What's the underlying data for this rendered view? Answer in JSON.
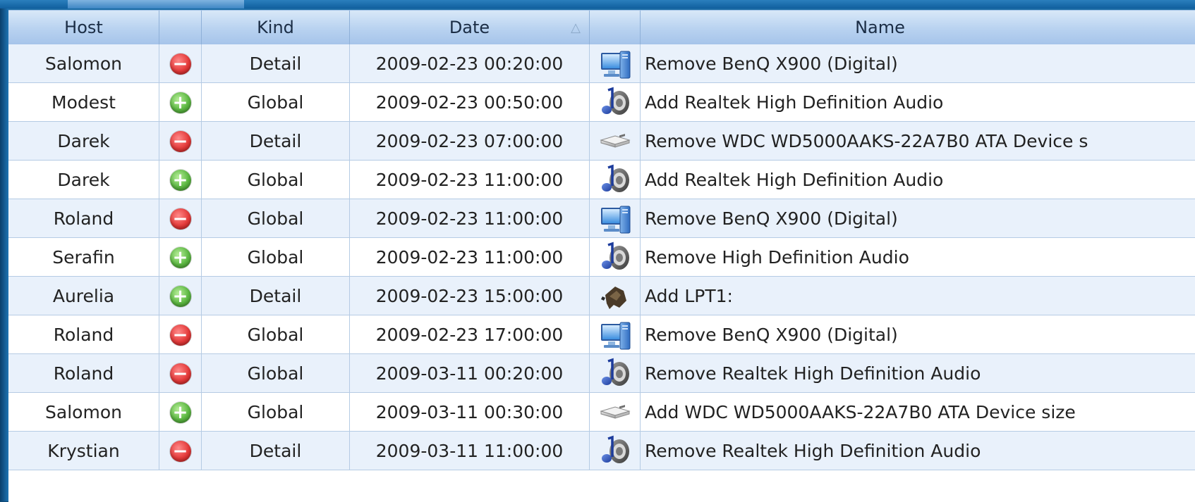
{
  "columns": {
    "host": "Host",
    "status": "",
    "kind": "Kind",
    "date": "Date",
    "sort_indicator": "△",
    "icon": "",
    "name": "Name"
  },
  "rows": [
    {
      "host": "Salomon",
      "action": "remove",
      "kind": "Detail",
      "date": "2009-02-23 00:20:00",
      "device_icon": "monitor-icon",
      "name": "Remove BenQ X900 (Digital)"
    },
    {
      "host": "Modest",
      "action": "add",
      "kind": "Global",
      "date": "2009-02-23 00:50:00",
      "device_icon": "audio-icon",
      "name": "Add Realtek High Definition Audio"
    },
    {
      "host": "Darek",
      "action": "remove",
      "kind": "Detail",
      "date": "2009-02-23 07:00:00",
      "device_icon": "hard-disk-icon",
      "name": "Remove WDC WD5000AAKS-22A7B0 ATA Device s"
    },
    {
      "host": "Darek",
      "action": "add",
      "kind": "Global",
      "date": "2009-02-23 11:00:00",
      "device_icon": "audio-icon",
      "name": "Add Realtek High Definition Audio"
    },
    {
      "host": "Roland",
      "action": "remove",
      "kind": "Global",
      "date": "2009-02-23 11:00:00",
      "device_icon": "monitor-icon",
      "name": "Remove BenQ X900 (Digital)"
    },
    {
      "host": "Serafin",
      "action": "add",
      "kind": "Global",
      "date": "2009-02-23 11:00:00",
      "device_icon": "audio-icon",
      "name": "Remove High Definition Audio"
    },
    {
      "host": "Aurelia",
      "action": "add",
      "kind": "Detail",
      "date": "2009-02-23 15:00:00",
      "device_icon": "port-icon",
      "name": "Add LPT1:"
    },
    {
      "host": "Roland",
      "action": "remove",
      "kind": "Global",
      "date": "2009-02-23 17:00:00",
      "device_icon": "monitor-icon",
      "name": "Remove BenQ X900 (Digital)"
    },
    {
      "host": "Roland",
      "action": "remove",
      "kind": "Global",
      "date": "2009-03-11 00:20:00",
      "device_icon": "audio-icon",
      "name": "Remove Realtek High Definition Audio"
    },
    {
      "host": "Salomon",
      "action": "add",
      "kind": "Global",
      "date": "2009-03-11 00:30:00",
      "device_icon": "hard-disk-icon",
      "name": "Add WDC WD5000AAKS-22A7B0 ATA Device size"
    },
    {
      "host": "Krystian",
      "action": "remove",
      "kind": "Detail",
      "date": "2009-03-11 11:00:00",
      "device_icon": "audio-icon",
      "name": "Remove Realtek High Definition Audio"
    }
  ],
  "colors": {
    "header_bg": "#b8d2f0",
    "row_alt_bg": "#e9f1fb",
    "add_green": "#5cb842",
    "remove_red": "#e43a3a"
  }
}
